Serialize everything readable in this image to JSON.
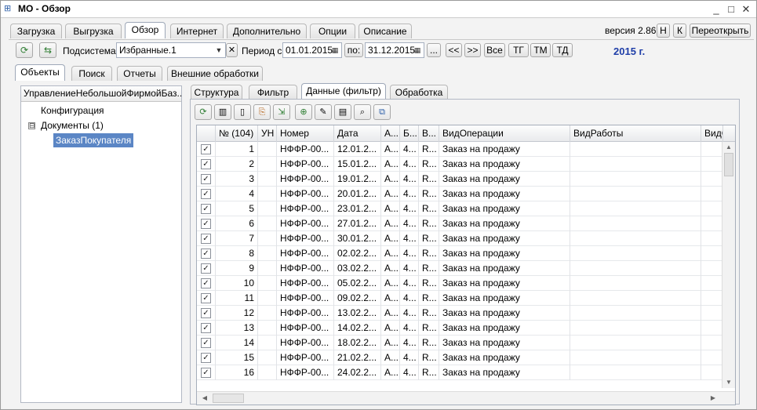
{
  "window": {
    "title": "МО - Обзор",
    "app_icon": "form-icon",
    "controls": {
      "minimize": "_",
      "maximize": "□",
      "close": "✕"
    }
  },
  "top_tabs": [
    "Загрузка",
    "Выгрузка",
    "Обзор",
    "Интернет",
    "Дополнительно",
    "Опции",
    "Описание"
  ],
  "top_tabs_active": "Обзор",
  "version": "версия 2.86",
  "top_buttons": {
    "h": "Н",
    "k": "К",
    "reopen": "Переоткрыть"
  },
  "subsystem": {
    "label": "Подсистема:",
    "value": "Избранные.1",
    "clear": "✕",
    "dropdown": "▼"
  },
  "period": {
    "label": "Период с:",
    "from": "01.01.2015",
    "to_label": "по:",
    "to": "31.12.2015",
    "ellipsis": "...",
    "prev": "<<",
    "next": ">>",
    "all": "Все",
    "tg": "ТГ",
    "tm": "ТМ",
    "td": "ТД"
  },
  "year_label": "2015 г.",
  "second_tabs": [
    "Объекты",
    "Поиск",
    "Отчеты",
    "Внешние обработки"
  ],
  "second_tabs_active": "Объекты",
  "tree": {
    "header": "УправлениеНебольшойФирмойБаз...",
    "items": [
      {
        "label": "Конфигурация"
      },
      {
        "label": "Документы (1)",
        "expander": "⊟"
      },
      {
        "label": "ЗаказПокупателя"
      }
    ]
  },
  "inner_tabs": [
    "Структура",
    "Фильтр",
    "Данные (фильтр)",
    "Обработка"
  ],
  "inner_tabs_active": "Данные (фильтр)",
  "grid": {
    "headers": [
      "",
      "№ (104)",
      "УН",
      "Номер",
      "Дата",
      "А...",
      "Б...",
      "В...",
      "ВидОперации",
      "ВидРаботы",
      "ВидС"
    ],
    "rows": [
      {
        "n": "1",
        "num": "НФФР-00...",
        "date": "12.01.2...",
        "a": "А...",
        "b": "4...",
        "v": "R...",
        "op": "Заказ на продажу"
      },
      {
        "n": "2",
        "num": "НФФР-00...",
        "date": "15.01.2...",
        "a": "А...",
        "b": "4...",
        "v": "R...",
        "op": "Заказ на продажу"
      },
      {
        "n": "3",
        "num": "НФФР-00...",
        "date": "19.01.2...",
        "a": "А...",
        "b": "4...",
        "v": "R...",
        "op": "Заказ на продажу"
      },
      {
        "n": "4",
        "num": "НФФР-00...",
        "date": "20.01.2...",
        "a": "А...",
        "b": "4...",
        "v": "R...",
        "op": "Заказ на продажу"
      },
      {
        "n": "5",
        "num": "НФФР-00...",
        "date": "23.01.2...",
        "a": "А...",
        "b": "4...",
        "v": "R...",
        "op": "Заказ на продажу"
      },
      {
        "n": "6",
        "num": "НФФР-00...",
        "date": "27.01.2...",
        "a": "А...",
        "b": "4...",
        "v": "R...",
        "op": "Заказ на продажу"
      },
      {
        "n": "7",
        "num": "НФФР-00...",
        "date": "30.01.2...",
        "a": "А...",
        "b": "4...",
        "v": "R...",
        "op": "Заказ на продажу"
      },
      {
        "n": "8",
        "num": "НФФР-00...",
        "date": "02.02.2...",
        "a": "А...",
        "b": "4...",
        "v": "R...",
        "op": "Заказ на продажу"
      },
      {
        "n": "9",
        "num": "НФФР-00...",
        "date": "03.02.2...",
        "a": "А...",
        "b": "4...",
        "v": "R...",
        "op": "Заказ на продажу"
      },
      {
        "n": "10",
        "num": "НФФР-00...",
        "date": "05.02.2...",
        "a": "А...",
        "b": "4...",
        "v": "R...",
        "op": "Заказ на продажу"
      },
      {
        "n": "11",
        "num": "НФФР-00...",
        "date": "09.02.2...",
        "a": "А...",
        "b": "4...",
        "v": "R...",
        "op": "Заказ на продажу"
      },
      {
        "n": "12",
        "num": "НФФР-00...",
        "date": "13.02.2...",
        "a": "А...",
        "b": "4...",
        "v": "R...",
        "op": "Заказ на продажу"
      },
      {
        "n": "13",
        "num": "НФФР-00...",
        "date": "14.02.2...",
        "a": "А...",
        "b": "4...",
        "v": "R...",
        "op": "Заказ на продажу"
      },
      {
        "n": "14",
        "num": "НФФР-00...",
        "date": "18.02.2...",
        "a": "А...",
        "b": "4...",
        "v": "R...",
        "op": "Заказ на продажу"
      },
      {
        "n": "15",
        "num": "НФФР-00...",
        "date": "21.02.2...",
        "a": "А...",
        "b": "4...",
        "v": "R...",
        "op": "Заказ на продажу"
      },
      {
        "n": "16",
        "num": "НФФР-00...",
        "date": "24.02.2...",
        "a": "А...",
        "b": "4...",
        "v": "R...",
        "op": "Заказ на продажу"
      }
    ]
  },
  "colors": {
    "accent": "#1f3ea8",
    "selection": "#5b86c5"
  }
}
